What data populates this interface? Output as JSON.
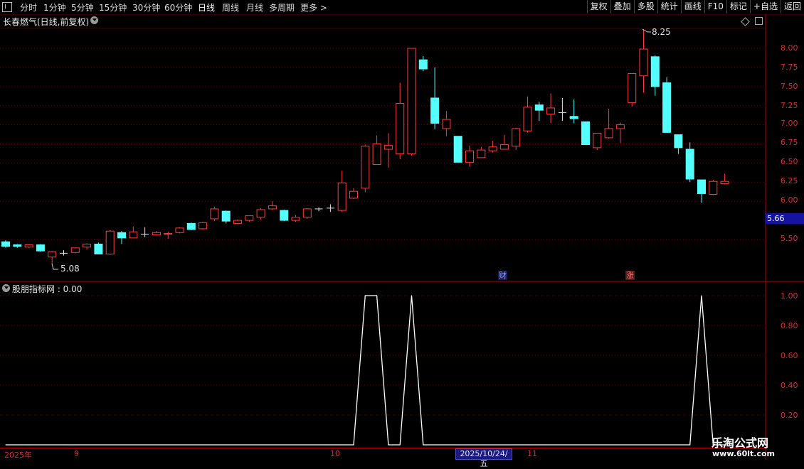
{
  "toolbar": {
    "periods": [
      "分时",
      "1分钟",
      "5分钟",
      "15分钟",
      "30分钟",
      "60分钟",
      "日线",
      "周线",
      "月线",
      "多周期",
      "更多 >"
    ],
    "actions": [
      "复权",
      "叠加",
      "多股",
      "统计",
      "画线",
      "F10",
      "标记",
      "+自选",
      "返回"
    ]
  },
  "main_title": "长春燃气(日线,前复权)",
  "indicator_title": "股朋指标网 : 0.00",
  "badges": {
    "cai": "财",
    "zhang": "涨"
  },
  "labels": {
    "high": "8.25",
    "low": "5.08",
    "current_price": "5.66"
  },
  "x_axis": {
    "year": "2025年",
    "sep": "9",
    "oct": "10",
    "nov": "11",
    "cursor_date": "2025/10/24/五"
  },
  "watermark": {
    "name": "乐淘公式网",
    "url": "www.60lt.com"
  },
  "chart_data": [
    {
      "type": "candlestick",
      "y_ticks": [
        "8.00",
        "7.75",
        "7.50",
        "7.25",
        "7.00",
        "6.75",
        "6.50",
        "6.25",
        "6.00",
        "5.50"
      ],
      "candles": [
        [
          5.47,
          5.41,
          5.49,
          5.39
        ],
        [
          5.43,
          5.41,
          5.44,
          5.39
        ],
        [
          5.4,
          5.43,
          5.43,
          5.39
        ],
        [
          5.43,
          5.35,
          5.44,
          5.34
        ],
        [
          5.27,
          5.34,
          5.35,
          5.18
        ],
        [
          5.32,
          5.32,
          5.36,
          5.29
        ],
        [
          5.33,
          5.39,
          5.4,
          5.32
        ],
        [
          5.4,
          5.44,
          5.45,
          5.37
        ],
        [
          5.44,
          5.31,
          5.46,
          5.31
        ],
        [
          5.31,
          5.61,
          5.62,
          5.3
        ],
        [
          5.59,
          5.52,
          5.61,
          5.44
        ],
        [
          5.52,
          5.6,
          5.67,
          5.52
        ],
        [
          5.57,
          5.57,
          5.66,
          5.53
        ],
        [
          5.56,
          5.59,
          5.61,
          5.55
        ],
        [
          5.57,
          5.58,
          5.6,
          5.51
        ],
        [
          5.59,
          5.65,
          5.66,
          5.58
        ],
        [
          5.71,
          5.63,
          5.72,
          5.62
        ],
        [
          5.64,
          5.72,
          5.73,
          5.63
        ],
        [
          5.77,
          5.9,
          5.93,
          5.74
        ],
        [
          5.87,
          5.74,
          5.88,
          5.71
        ],
        [
          5.71,
          5.75,
          5.76,
          5.7
        ],
        [
          5.75,
          5.81,
          5.81,
          5.73
        ],
        [
          5.79,
          5.89,
          5.91,
          5.76
        ],
        [
          5.9,
          5.94,
          6.0,
          5.89
        ],
        [
          5.88,
          5.75,
          5.89,
          5.74
        ],
        [
          5.75,
          5.79,
          5.82,
          5.73
        ],
        [
          5.79,
          5.9,
          5.91,
          5.77
        ],
        [
          5.9,
          5.9,
          5.92,
          5.87
        ],
        [
          5.91,
          5.91,
          5.96,
          5.86
        ],
        [
          5.88,
          6.24,
          6.4,
          5.86
        ],
        [
          6.04,
          6.13,
          6.17,
          6.03
        ],
        [
          6.17,
          6.72,
          6.74,
          6.12
        ],
        [
          6.48,
          6.75,
          6.86,
          6.48
        ],
        [
          6.68,
          6.73,
          6.89,
          6.44
        ],
        [
          6.62,
          7.28,
          7.55,
          6.55
        ],
        [
          6.62,
          8.0,
          8.0,
          6.6
        ],
        [
          7.85,
          7.73,
          7.9,
          7.7
        ],
        [
          7.35,
          7.02,
          7.75,
          6.95
        ],
        [
          6.95,
          7.07,
          7.18,
          6.85
        ],
        [
          6.85,
          6.51,
          6.85,
          6.52
        ],
        [
          6.51,
          6.66,
          6.73,
          6.45
        ],
        [
          6.57,
          6.67,
          6.71,
          6.57
        ],
        [
          6.66,
          6.71,
          6.79,
          6.64
        ],
        [
          6.68,
          6.74,
          6.87,
          6.68
        ],
        [
          6.72,
          6.95,
          6.96,
          6.67
        ],
        [
          6.92,
          7.23,
          7.37,
          6.9
        ],
        [
          7.26,
          7.19,
          7.3,
          7.05
        ],
        [
          7.14,
          7.22,
          7.41,
          7.02
        ],
        [
          7.16,
          7.16,
          7.35,
          7.05
        ],
        [
          7.11,
          7.08,
          7.33,
          7.02
        ],
        [
          7.04,
          6.74,
          7.03,
          6.74
        ],
        [
          6.7,
          6.89,
          6.89,
          6.67
        ],
        [
          6.83,
          6.95,
          7.21,
          6.82
        ],
        [
          6.95,
          7.0,
          7.03,
          6.76
        ],
        [
          7.29,
          7.67,
          7.67,
          7.24
        ],
        [
          7.64,
          7.99,
          8.25,
          7.42
        ],
        [
          7.89,
          7.5,
          7.91,
          7.38
        ],
        [
          7.55,
          6.9,
          7.62,
          6.9
        ],
        [
          6.87,
          6.7,
          6.87,
          6.62
        ],
        [
          6.68,
          6.29,
          6.77,
          6.25
        ],
        [
          6.28,
          6.1,
          6.28,
          5.98
        ],
        [
          6.09,
          6.26,
          6.28,
          6.08
        ],
        [
          6.23,
          6.26,
          6.36,
          6.22
        ]
      ]
    },
    {
      "type": "line",
      "name": "股朋指标网",
      "y_ticks": [
        "1.00",
        "0.80",
        "0.60",
        "0.40",
        "0.20"
      ],
      "values": [
        0,
        0,
        0,
        0,
        0,
        0,
        0,
        0,
        0,
        0,
        0,
        0,
        0,
        0,
        0,
        0,
        0,
        0,
        0,
        0,
        0,
        0,
        0,
        0,
        0,
        0,
        0,
        0,
        0,
        0,
        0,
        1,
        1,
        0,
        0,
        1,
        0,
        0,
        0,
        0,
        0,
        0,
        0,
        0,
        0,
        0,
        0,
        0,
        0,
        0,
        0,
        0,
        0,
        0,
        0,
        0,
        0,
        0,
        0,
        0,
        1,
        0,
        0
      ]
    }
  ]
}
